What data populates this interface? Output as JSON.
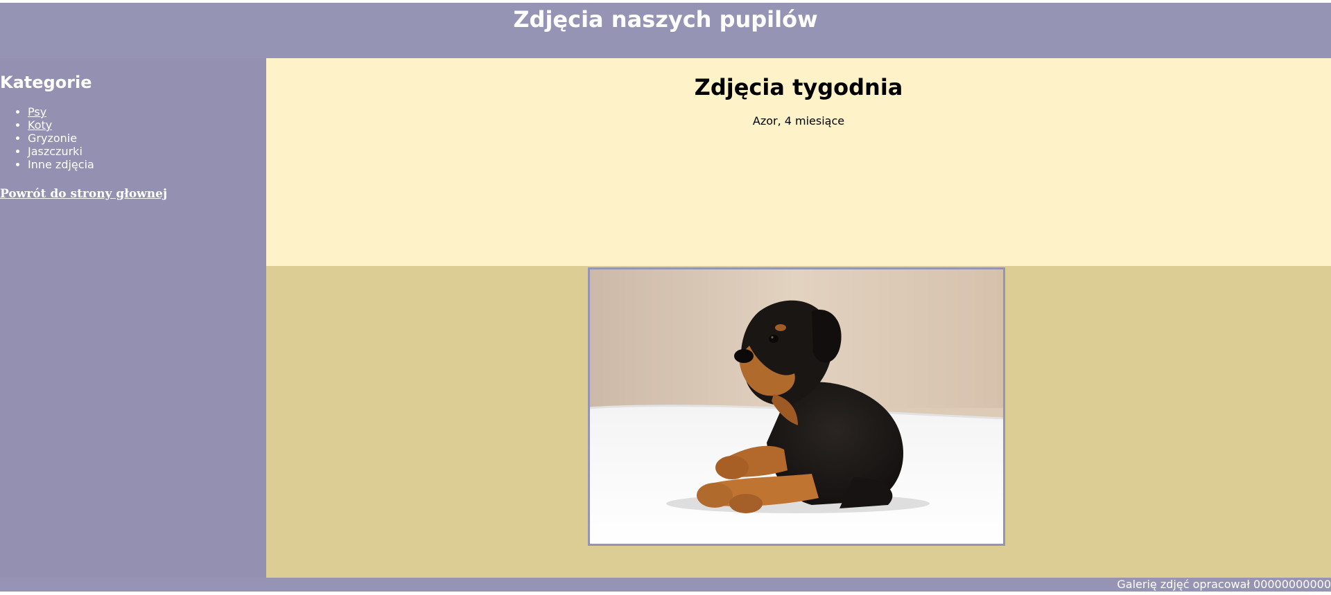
{
  "header": {
    "title": "Zdjęcia naszych pupilów"
  },
  "sidebar": {
    "heading": "Kategorie",
    "categories": [
      {
        "label": "Psy",
        "link": true
      },
      {
        "label": "Koty",
        "link": true
      },
      {
        "label": "Gryzonie",
        "link": false
      },
      {
        "label": "Jaszczurki",
        "link": false
      },
      {
        "label": "Inne zdjęcia",
        "link": false
      }
    ],
    "home_link": "Powrót do strony głownej"
  },
  "main": {
    "title": "Zdjęcia tygodnia",
    "caption": "Azor, 4 miesiące",
    "photo": {
      "subject": "rottweiler puppy lying on white blanket"
    }
  },
  "footer": {
    "text": "Galerię zdjęć opracował 00000000000"
  },
  "colors": {
    "header_bg": "#9694b4",
    "sidebar_bg": "#9390b2",
    "week_panel_bg": "#fdf2c8",
    "photo_panel_bg": "#dbcd93",
    "photo_border": "#9694b4"
  }
}
